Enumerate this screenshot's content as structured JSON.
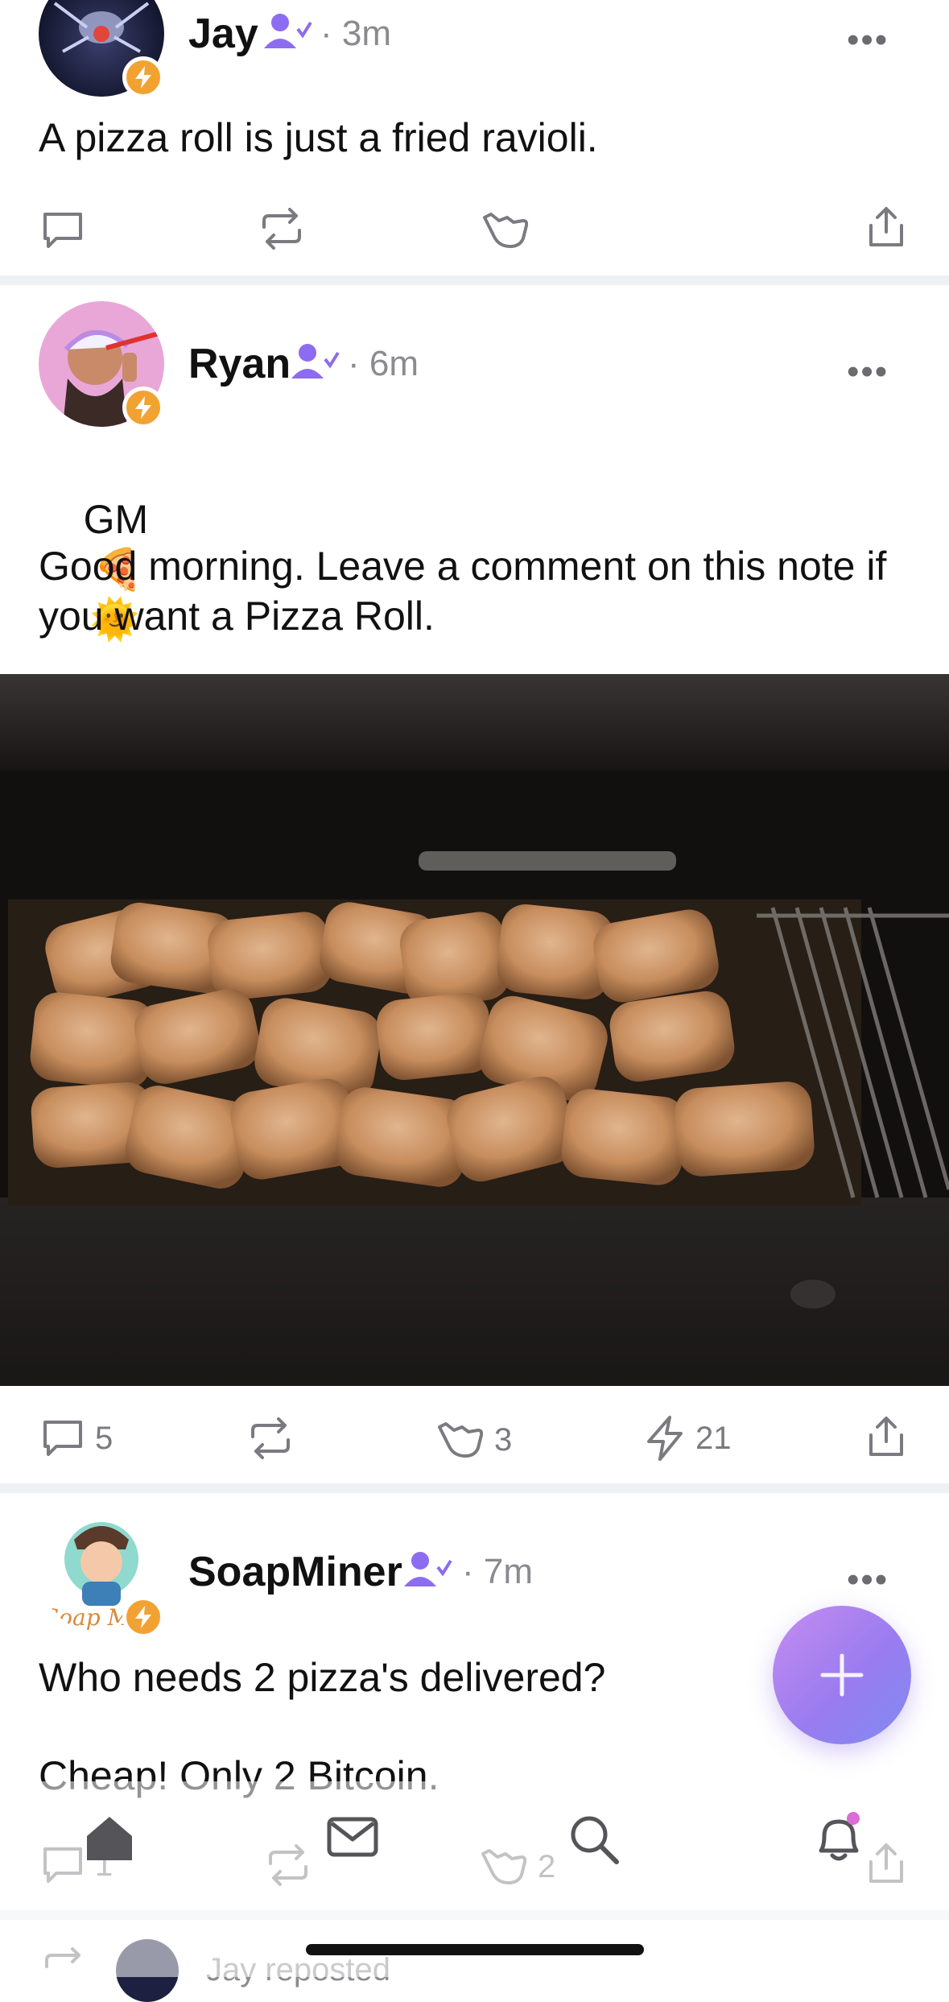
{
  "posts": [
    {
      "name": "Jay",
      "time": "· 3m",
      "text": "A pizza roll is just a fried ravioli.",
      "actions": {
        "reply": "",
        "repost": "",
        "like": "",
        "zap": "",
        "share": ""
      }
    },
    {
      "name": "Ryan",
      "time": "· 6m",
      "text_line1": "GM",
      "text_body": "Good morning. Leave a comment on this note if\nyou want a Pizza Roll.",
      "media_description": "photo",
      "actions": {
        "reply": "5",
        "repost": "",
        "like": "3",
        "zap": "21",
        "share": ""
      }
    },
    {
      "name": "SoapMiner",
      "avatar_text": "Soap Mi",
      "time": "· 7m",
      "text_line1": "Who needs 2 pizza's delivered?",
      "text_line2": "Cheap! Only 2 Bitcoin.",
      "actions": {
        "reply": "1",
        "repost": "",
        "like": "2",
        "zap": "",
        "share": ""
      }
    }
  ],
  "next_post": {
    "repost_label": "Jay reposted"
  },
  "more_label": "•••",
  "emojis": [
    "🍕",
    "🌞"
  ],
  "colors": {
    "accent": "#9a7cf0",
    "zap_badge": "#f2a233",
    "verified": "#8c6cf0",
    "notification_dot": "#d96cd6",
    "divider": "#eef0f3"
  },
  "tabbar": {
    "tabs": [
      "home-icon",
      "mail-icon",
      "search-icon",
      "bell-icon"
    ]
  }
}
